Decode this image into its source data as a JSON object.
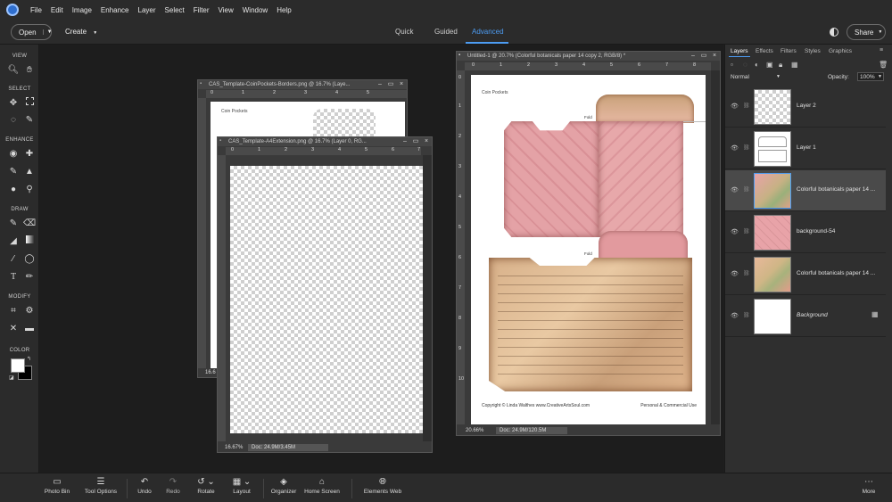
{
  "menu": [
    "File",
    "Edit",
    "Image",
    "Enhance",
    "Layer",
    "Select",
    "Filter",
    "View",
    "Window",
    "Help"
  ],
  "topbar": {
    "open_label": "Open",
    "create_label": "Create",
    "modes": [
      "Quick",
      "Guided",
      "Advanced"
    ],
    "active_mode": "Advanced",
    "share_label": "Share"
  },
  "tools": {
    "sections": [
      "VIEW",
      "SELECT",
      "ENHANCE",
      "DRAW",
      "MODIFY",
      "COLOR"
    ]
  },
  "docs": {
    "doc1": {
      "title": "CAS_Template-CoinPockets-Borders.png @ 16.7% (Laye...",
      "zoom": "16.6",
      "ruler": [
        "0",
        "1",
        "2",
        "3",
        "4",
        "5"
      ],
      "header": "Coin Pockets"
    },
    "doc2": {
      "title": "CAS_Template-A4Extension.png @ 16.7% (Layer 0, RG...",
      "zoom": "16.67%",
      "doc_info": "Doc: 24.9M/3.45M",
      "ruler": [
        "0",
        "1",
        "2",
        "3",
        "4",
        "5",
        "6",
        "7"
      ]
    },
    "doc3": {
      "title": "Untitled-1 @ 20.7% (Colorful botanicals paper 14 copy 2, RGB/8) *",
      "zoom": "20.66%",
      "doc_info": "Doc: 24.9M/120.5M",
      "ruler": [
        "0",
        "1",
        "2",
        "3",
        "4",
        "5",
        "6",
        "7",
        "8"
      ],
      "vruler": [
        "0",
        "1",
        "2",
        "3",
        "4",
        "5",
        "6",
        "7",
        "8",
        "9",
        "10"
      ],
      "header": "Coin Pockets",
      "fold1": "Fold",
      "fold2": "Fold",
      "footer_left": "Copyright © Linda Walthes www.CreativeArtsSoul.com",
      "footer_right": "Personal & Commercial Use"
    }
  },
  "layers_panel": {
    "tabs": [
      "Layers",
      "Effects",
      "Filters",
      "Styles",
      "Graphics"
    ],
    "blend_mode": "Normal",
    "opacity_label": "Opacity:",
    "opacity_value": "100%",
    "layers": [
      {
        "name": "Layer 2",
        "thumb": "checker"
      },
      {
        "name": "Layer 1",
        "thumb": "template"
      },
      {
        "name": "Colorful botanicals paper 14 ...",
        "thumb": "floral",
        "selected": true
      },
      {
        "name": "background-54",
        "thumb": "pink"
      },
      {
        "name": "Colorful botanicals paper 14 ...",
        "thumb": "floral"
      },
      {
        "name": "Background",
        "thumb": "white",
        "italic": true
      }
    ]
  },
  "bottombar": {
    "items": [
      "Photo Bin",
      "Tool Options",
      "Undo",
      "Redo",
      "Rotate",
      "Layout",
      "Organizer",
      "Home Screen",
      "Elements Web"
    ],
    "more": "More"
  },
  "colors": {
    "accent": "#4d9cf2",
    "pink": "#e8a3a8",
    "parchment": "#d9b38a"
  }
}
